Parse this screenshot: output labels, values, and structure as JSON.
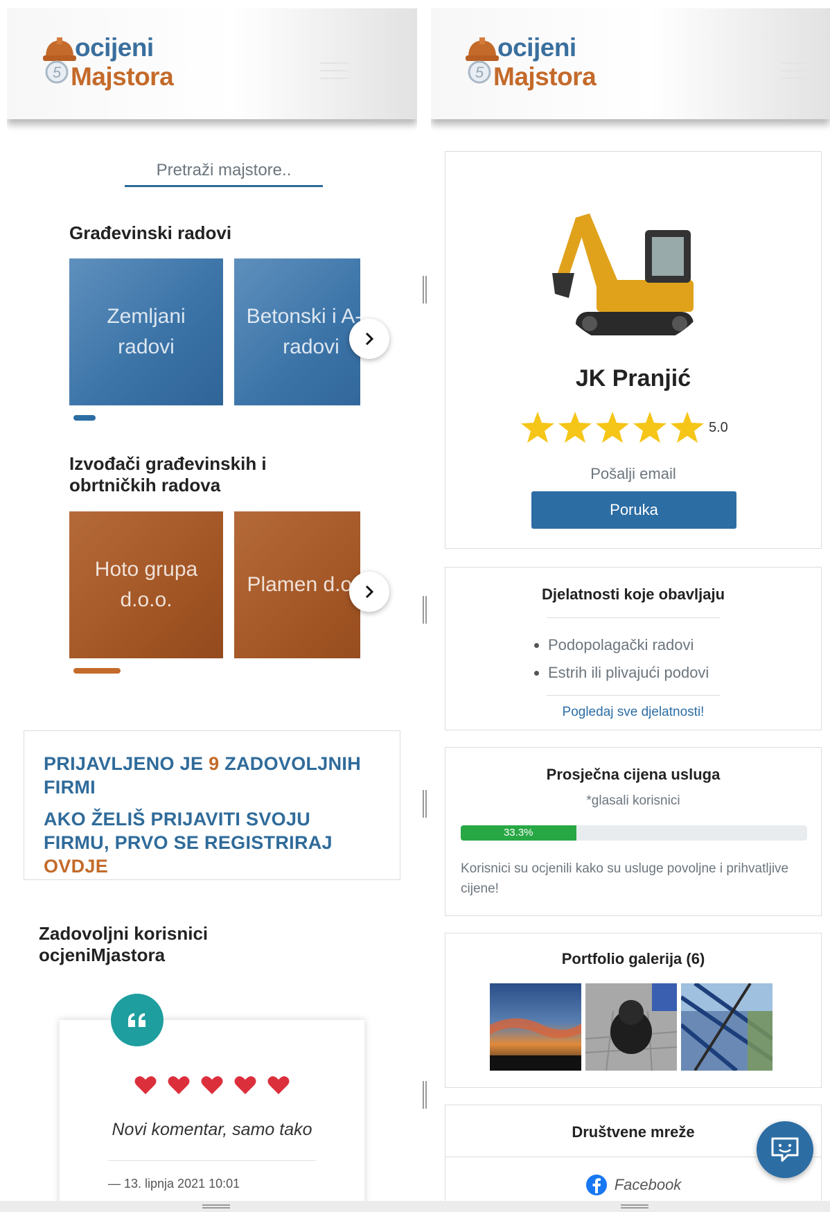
{
  "brand": {
    "line1": "ocijeni",
    "line2": "Majstora",
    "badge": "5",
    "primary_color": "#2c6da4",
    "accent_color": "#c46a2a"
  },
  "left": {
    "search": {
      "placeholder": "Pretraži majstore.."
    },
    "sections": [
      {
        "title": "Građevinski radovi",
        "cards": [
          "Zemljani radovi",
          "Betonski i A-B radovi"
        ]
      },
      {
        "title": "Izvođači građevinskih i obrtničkih radova",
        "cards": [
          "Hoto grupa d.o.o.",
          "Plamen d.o.o."
        ]
      }
    ],
    "promo": {
      "line1_pre": "PRIJAVLJENO JE ",
      "line1_count": "9",
      "line1_post": " ZADOVOLJNIH FIRMI",
      "line2_pre": "AKO ŽELIŠ PRIJAVITI SVOJU FIRMU, PRVO SE REGISTRIRAJ ",
      "line2_link": "OVDJE"
    },
    "users_title": "Zadovoljni korisnici ocjeniMjastora",
    "testimonial": {
      "hearts": 5,
      "comment": "Novi komentar, samo tako",
      "date": "— 13. lipnja 2021 10:01"
    }
  },
  "right": {
    "profile": {
      "name": "JK Pranjić",
      "stars": 5,
      "rating": "5.0",
      "email_label": "Pošalji email",
      "message_button": "Poruka"
    },
    "activities": {
      "title": "Djelatnosti koje obavljaju",
      "items": [
        "Podopolagački radovi",
        "Estrih ili plivajući podovi"
      ],
      "see_all": "Pogledaj sve djelatnosti!"
    },
    "price": {
      "title": "Prosječna cijena usluga",
      "subtitle": "*glasali korisnici",
      "progress_label": "33.3%",
      "progress_value": 33.3,
      "note": "Korisnici su ocjenili kako su usluge povoljne i prihvatljive cijene!"
    },
    "portfolio": {
      "title": "Portfolio galerija (6)"
    },
    "social": {
      "title": "Društvene mreže",
      "facebook": "Facebook"
    }
  }
}
